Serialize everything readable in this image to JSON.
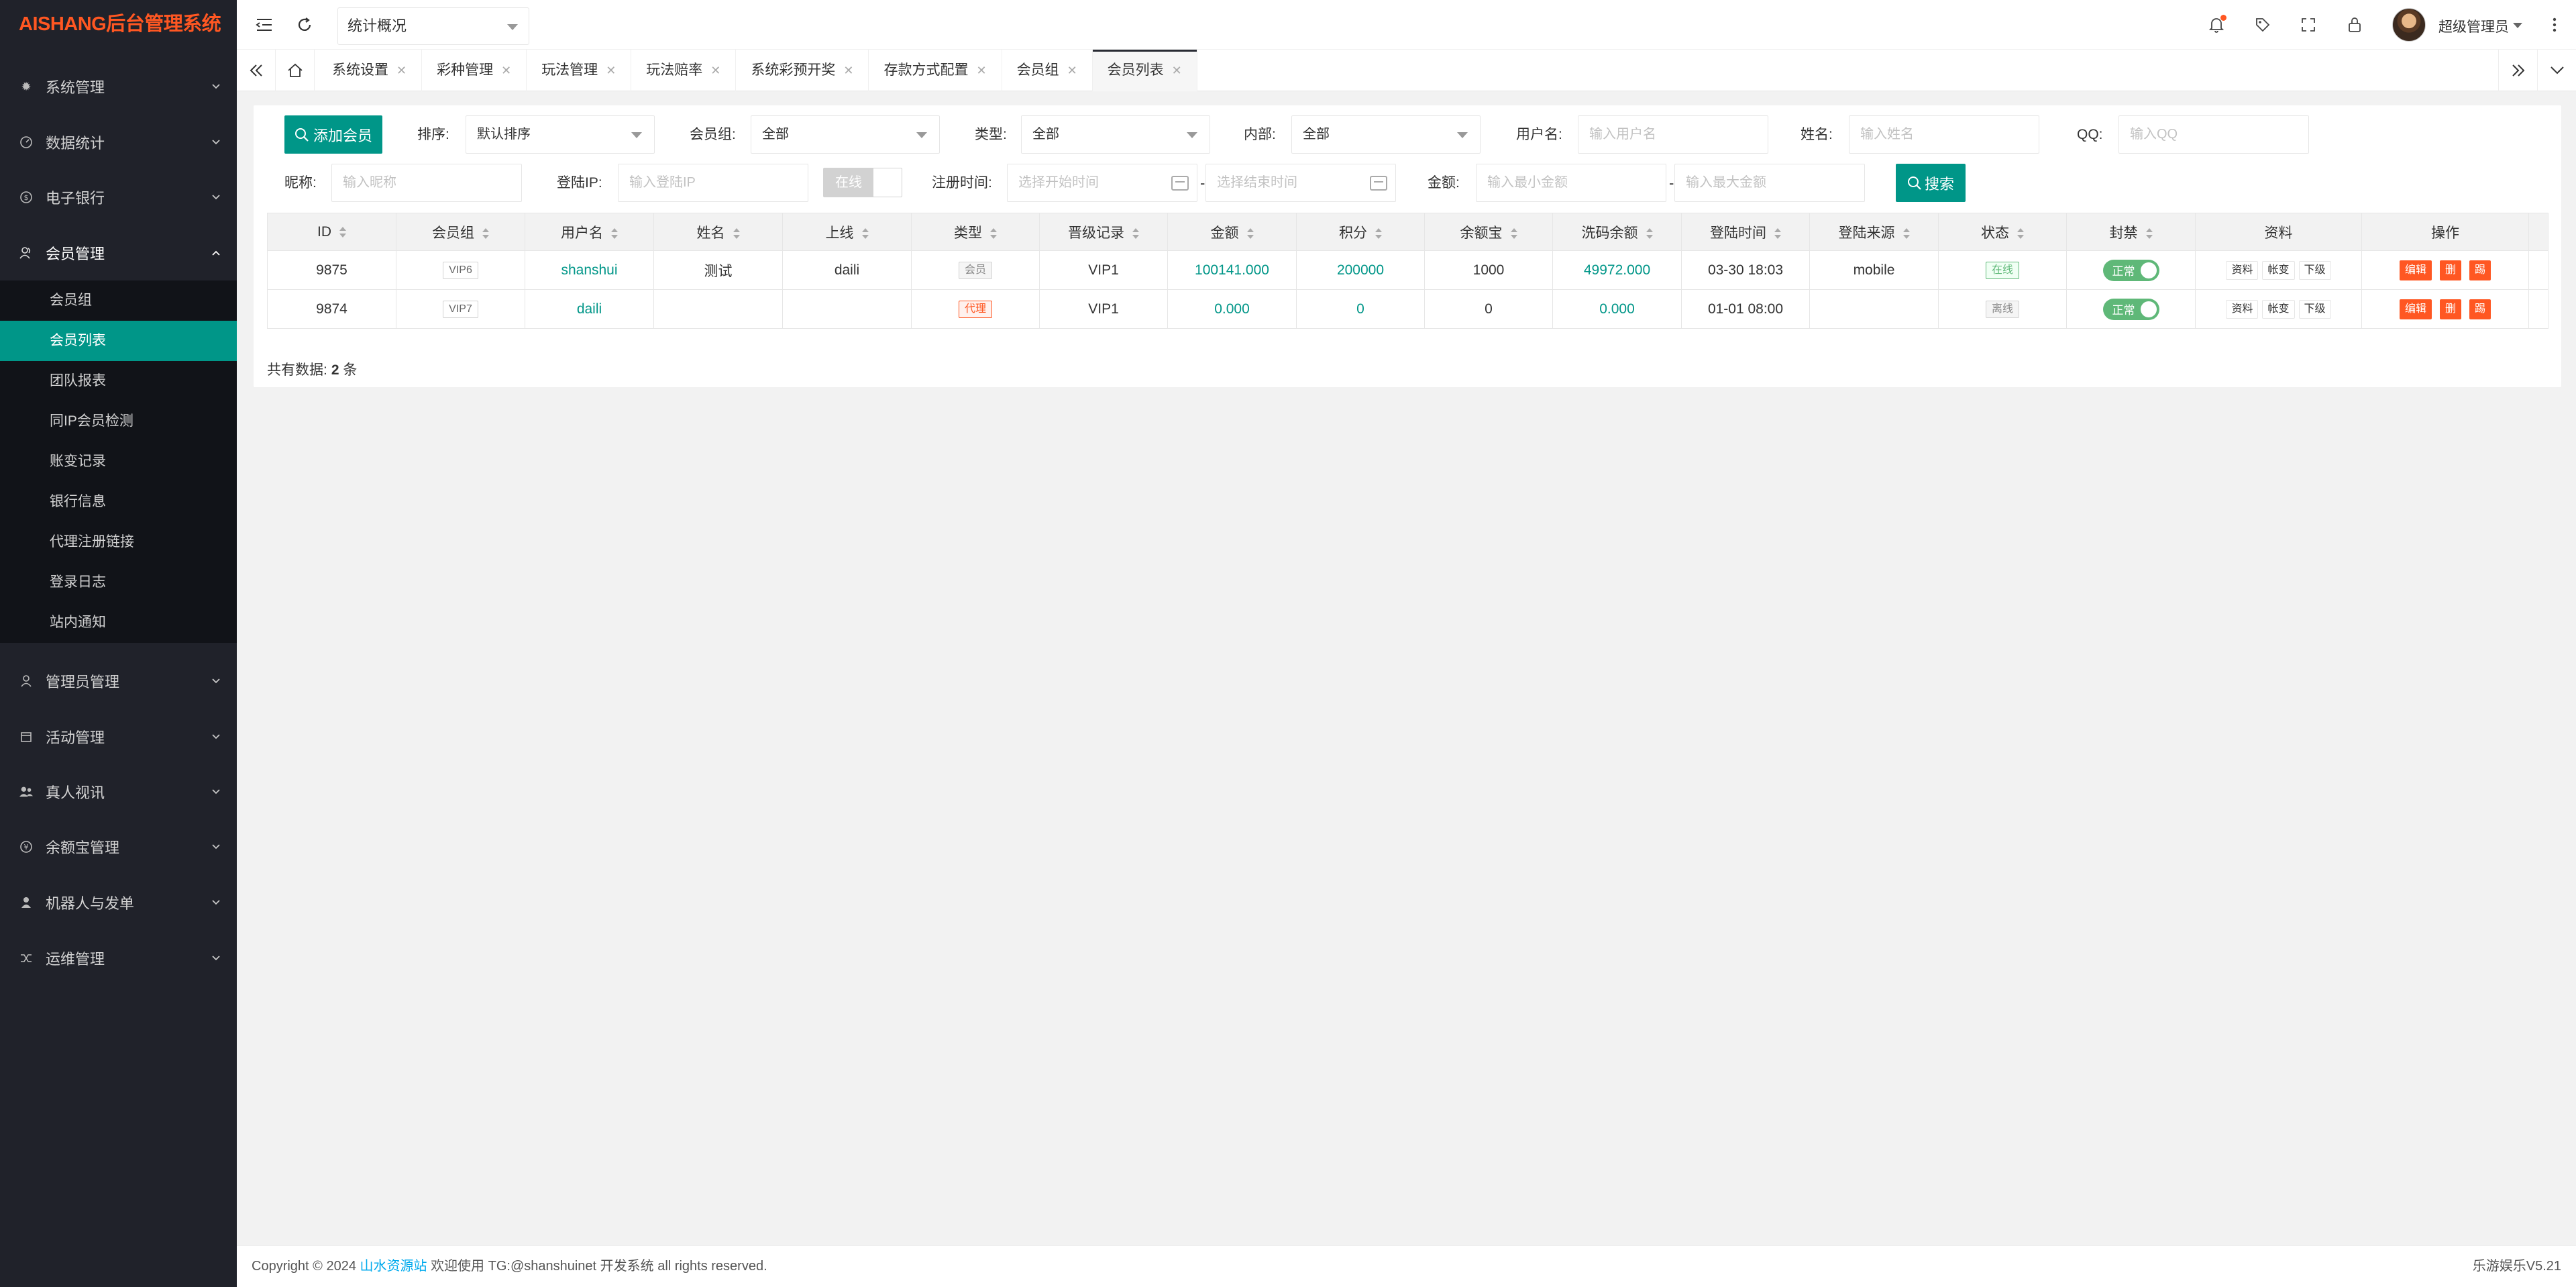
{
  "sidebar": {
    "logo": "AISHANG后台管理系统",
    "groups": [
      {
        "label": "系统管理",
        "icon": "gear-icon"
      },
      {
        "label": "数据统计",
        "icon": "dashboard-icon"
      },
      {
        "label": "电子银行",
        "icon": "money-icon"
      },
      {
        "label": "会员管理",
        "icon": "users-icon",
        "expanded": true,
        "items": [
          "会员组",
          "会员列表",
          "团队报表",
          "同IP会员检测",
          "账变记录",
          "银行信息",
          "代理注册链接",
          "登录日志",
          "站内通知"
        ],
        "active_item": "会员列表"
      },
      {
        "label": "管理员管理",
        "icon": "user-icon"
      },
      {
        "label": "活动管理",
        "icon": "calendar-icon"
      },
      {
        "label": "真人视讯",
        "icon": "group-icon"
      },
      {
        "label": "余额宝管理",
        "icon": "yen-icon"
      },
      {
        "label": "机器人与发单",
        "icon": "robot-icon"
      },
      {
        "label": "运维管理",
        "icon": "shuffle-icon"
      }
    ]
  },
  "topbar": {
    "select_value": "统计概况",
    "admin_name": "超级管理员"
  },
  "tabs": [
    "系统设置",
    "彩种管理",
    "玩法管理",
    "玩法赔率",
    "系统彩预开奖",
    "存款方式配置",
    "会员组",
    "会员列表"
  ],
  "active_tab": "会员列表",
  "filters": {
    "add_button": "添加会员",
    "sort_label": "排序:",
    "sort_value": "默认排序",
    "group_label": "会员组:",
    "group_value": "全部",
    "type_label": "类型:",
    "type_value": "全部",
    "internal_label": "内部:",
    "internal_value": "全部",
    "username_label": "用户名:",
    "username_placeholder": "输入用户名",
    "name_label": "姓名:",
    "name_placeholder": "输入姓名",
    "qq_label": "QQ:",
    "qq_placeholder": "输入QQ",
    "nickname_label": "昵称:",
    "nickname_placeholder": "输入昵称",
    "loginip_label": "登陆IP:",
    "loginip_placeholder": "输入登陆IP",
    "online_switch": "在线",
    "regtime_label": "注册时间:",
    "regtime_start_placeholder": "选择开始时间",
    "regtime_end_placeholder": "选择结束时间",
    "range_sep": "-",
    "amount_label": "金额:",
    "amount_min_placeholder": "输入最小金额",
    "amount_max_placeholder": "输入最大金额",
    "search_button": "搜索"
  },
  "table": {
    "headers": [
      "ID",
      "会员组",
      "用户名",
      "姓名",
      "上线",
      "类型",
      "晋级记录",
      "金额",
      "积分",
      "余额宝",
      "洗码余额",
      "登陆时间",
      "登陆来源",
      "状态",
      "封禁",
      "资料",
      "操作"
    ],
    "rows": [
      {
        "id": "9875",
        "group": "VIP6",
        "username": "shanshui",
        "name": "测试",
        "upline": "daili",
        "type": "会员",
        "level_record": "VIP1",
        "amount": "100141.000",
        "points": "200000",
        "yuebao": "1000",
        "wash_balance": "49972.000",
        "login_time": "03-30 18:03",
        "login_source": "mobile",
        "status": "在线",
        "ban": "正常"
      },
      {
        "id": "9874",
        "group": "VIP7",
        "username": "daili",
        "name": "",
        "upline": "",
        "type": "代理",
        "level_record": "VIP1",
        "amount": "0.000",
        "points": "0",
        "yuebao": "0",
        "wash_balance": "0.000",
        "login_time": "01-01 08:00",
        "login_source": "",
        "status": "离线",
        "ban": "正常"
      }
    ],
    "info_buttons": [
      "资料",
      "帐变",
      "下级"
    ],
    "op_buttons": [
      "编辑",
      "删",
      "踢"
    ]
  },
  "total_label": "共有数据:",
  "total_count": "2",
  "total_unit": "条",
  "footer": {
    "copyright": "Copyright © 2024",
    "link_text": "山水资源站",
    "rest": "欢迎使用 TG:@shanshuinet 开发系统 all rights reserved.",
    "version": "乐游娱乐V5.21"
  },
  "colors": {
    "accent": "#009688",
    "danger": "#ff5722",
    "sidebar": "#20222a"
  }
}
